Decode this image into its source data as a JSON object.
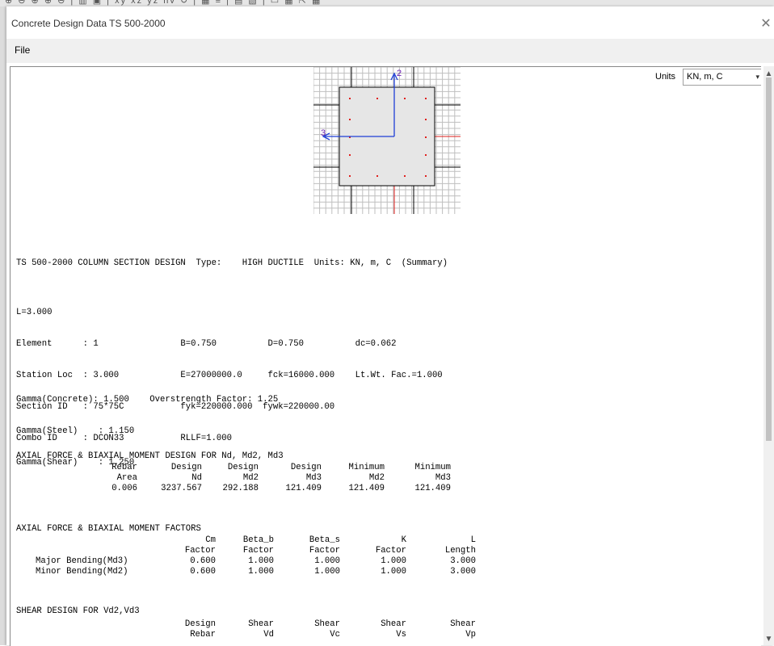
{
  "window": {
    "title": "Concrete Design Data  TS 500-2000",
    "close_glyph": "✕",
    "menu": [
      "File"
    ]
  },
  "units": {
    "label": "Units",
    "value": "KN, m, C"
  },
  "section_figure": {
    "axis2_label": "2",
    "axis3_label": "3",
    "axis_color": "#1f3fd6",
    "rebar_color": "#e0201e",
    "concrete_color": "#e6e6e6"
  },
  "report": {
    "header": "TS 500-2000 COLUMN SECTION DESIGN  Type:    HIGH DUCTILE  Units: KN, m, C  (Summary)",
    "info_lines": [
      "L=3.000",
      "Element      : 1                B=0.750          D=0.750          dc=0.062",
      "Station Loc  : 3.000            E=27000000.0     fck=16000.000    Lt.Wt. Fac.=1.000",
      "Section ID   : 75*75C           fyk=220000.000  fywk=220000.00",
      "Combo ID     : DCON33           RLLF=1.000"
    ],
    "gamma_lines": [
      "Gamma(Concrete): 1.500    Overstrength Factor: 1.25",
      "Gamma(Steel)    : 1.150",
      "Gamma(Shear)    : 1.250"
    ],
    "axial": {
      "title": "AXIAL FORCE & BIAXIAL MOMENT DESIGN FOR Nd, Md2, Md3",
      "header1": [
        "Rebar",
        "Design",
        "Design",
        "Design",
        "Minimum",
        "Minimum"
      ],
      "header2": [
        "Area",
        "Nd",
        "Md2",
        "Md3",
        "Md2",
        "Md3"
      ],
      "values": [
        "0.006",
        "3237.567",
        "292.188",
        "121.409",
        "121.409",
        "121.409"
      ]
    },
    "factors": {
      "title": "AXIAL FORCE & BIAXIAL MOMENT FACTORS",
      "header1": [
        "Cm",
        "Beta_b",
        "Beta_s",
        "K",
        "L"
      ],
      "header2": [
        "Factor",
        "Factor",
        "Factor",
        "Factor",
        "Length"
      ],
      "rows": [
        {
          "label": "Major Bending(Md3)",
          "values": [
            "0.600",
            "1.000",
            "1.000",
            "1.000",
            "3.000"
          ]
        },
        {
          "label": "Minor Bending(Md2)",
          "values": [
            "0.600",
            "1.000",
            "1.000",
            "1.000",
            "3.000"
          ]
        }
      ]
    },
    "shear": {
      "title": "SHEAR DESIGN FOR Vd2,Vd3",
      "header1": [
        "Design",
        "Shear",
        "Shear",
        "Shear",
        "Shear"
      ],
      "header2": [
        "Rebar",
        "Vd",
        "Vc",
        "Vs",
        "Vp"
      ]
    }
  }
}
